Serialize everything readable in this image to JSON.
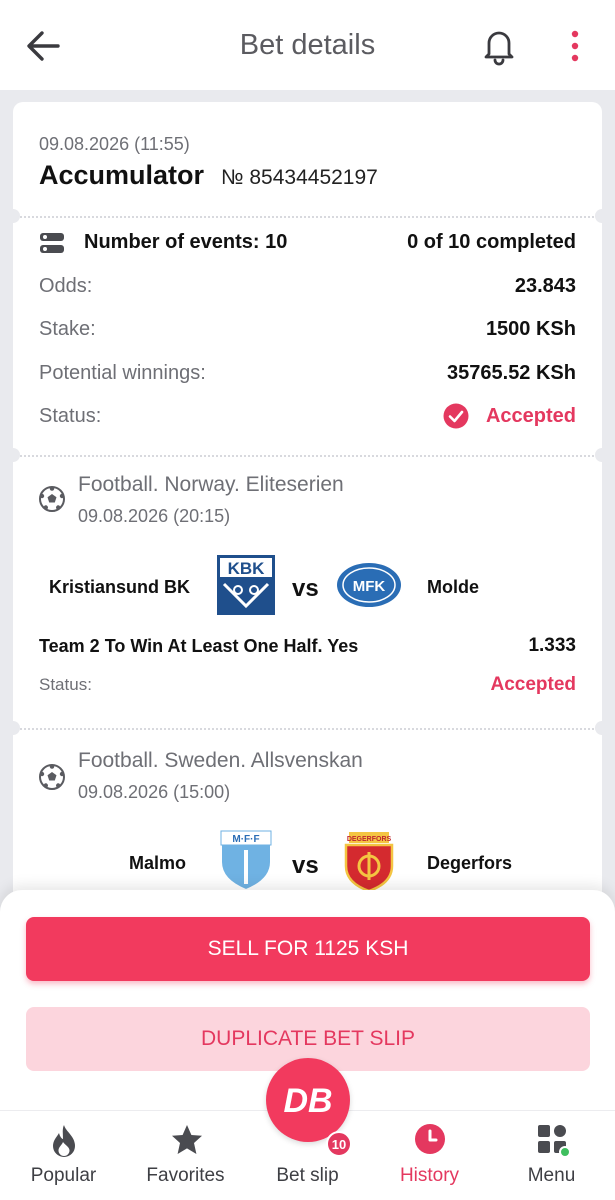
{
  "header": {
    "title": "Bet details"
  },
  "bet": {
    "date": "09.08.2026 (11:55)",
    "type": "Accumulator",
    "number": "№ 85434452197",
    "events_label": "Number of events: 10",
    "completed": "0 of 10 completed",
    "odds_label": "Odds:",
    "odds_value": "23.843",
    "stake_label": "Stake:",
    "stake_value": "1500 KSh",
    "winnings_label": "Potential winnings:",
    "winnings_value": "35765.52 KSh",
    "status_label": "Status:",
    "status_value": "Accepted"
  },
  "events": [
    {
      "league": "Football. Norway. Eliteserien",
      "date": "09.08.2026 (20:15)",
      "team1": "Kristiansund BK",
      "team2": "Molde",
      "vs": "vs",
      "team1_logo_text": "KBK",
      "team2_logo_text": "MFK",
      "market": "Team 2 To Win At Least One Half. Yes",
      "odds": "1.333",
      "status_label": "Status:",
      "status_value": "Accepted"
    },
    {
      "league": "Football. Sweden. Allsvenskan",
      "date": "09.08.2026 (15:00)",
      "team1": "Malmo",
      "team2": "Degerfors",
      "vs": "vs",
      "team1_logo_text": "M·F·F",
      "team2_logo_text": "DEGERFORS"
    }
  ],
  "actions": {
    "sell_label": "SELL FOR 1125 KSH",
    "duplicate_label": "DUPLICATE BET SLIP"
  },
  "nav": {
    "items": [
      {
        "label": "Popular",
        "icon": "flame-icon"
      },
      {
        "label": "Favorites",
        "icon": "star-icon"
      },
      {
        "label": "Bet slip",
        "icon": "db-logo"
      },
      {
        "label": "History",
        "icon": "clock-icon"
      },
      {
        "label": "Menu",
        "icon": "grid-icon"
      }
    ],
    "betslip_logo": "DB",
    "betslip_count": "10"
  },
  "colors": {
    "accent": "#e4385f",
    "primary_button": "#f23a5e",
    "secondary_button": "#fcd5dd",
    "online_dot": "#3fbf5f"
  }
}
